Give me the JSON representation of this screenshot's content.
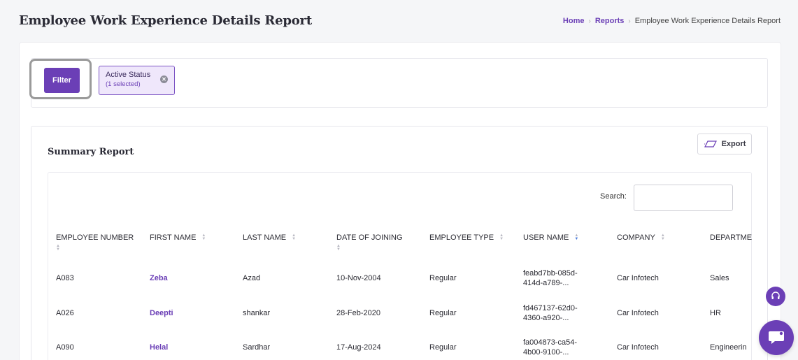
{
  "header": {
    "title": "Employee Work Experience Details Report",
    "breadcrumb": {
      "home": "Home",
      "reports": "Reports",
      "current": "Employee Work Experience Details Report"
    }
  },
  "filters": {
    "button_label": "Filter",
    "chip": {
      "label": "Active Status",
      "sub": "(1 selected)"
    }
  },
  "summary": {
    "title": "Summary Report",
    "export_label": "Export",
    "search_label": "Search:",
    "search_value": ""
  },
  "table": {
    "columns": [
      "EMPLOYEE NUMBER",
      "FIRST NAME",
      "LAST NAME",
      "DATE OF JOINING",
      "EMPLOYEE TYPE",
      "USER NAME",
      "COMPANY",
      "DEPARTME"
    ],
    "rows": [
      [
        "A083",
        "Zeba",
        "Azad",
        "10-Nov-2004",
        "Regular",
        "feabd7bb-085d-414d-a789-...",
        "Car Infotech",
        "Sales"
      ],
      [
        "A026",
        "Deepti",
        "shankar",
        "28-Feb-2020",
        "Regular",
        "fd467137-62d0-4360-a920-...",
        "Car Infotech",
        "HR"
      ],
      [
        "A090",
        "Helal",
        "Sardhar",
        "17-Aug-2024",
        "Regular",
        "fa004873-ca54-4b00-9100-...",
        "Car Infotech",
        "Engineerin"
      ]
    ]
  },
  "colors": {
    "accent": "#6b3fb6",
    "chip_bg": "#efe7fb",
    "sort_active": "#4a7bdc"
  }
}
